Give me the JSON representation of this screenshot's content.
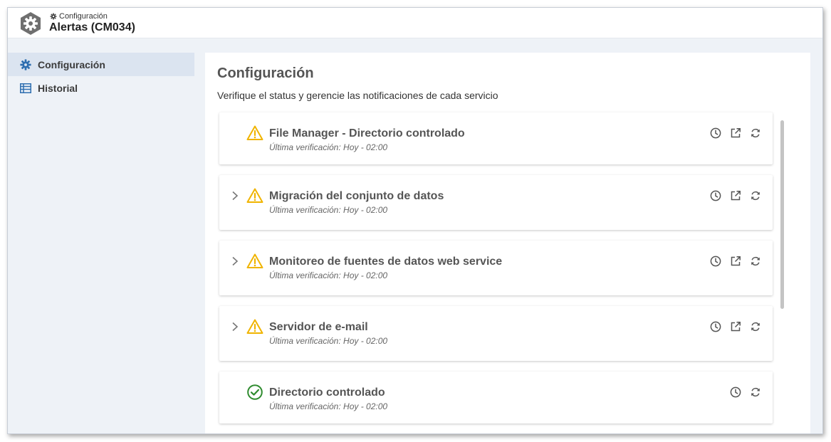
{
  "header": {
    "breadcrumb": "Configuración",
    "title": "Alertas (CM034)"
  },
  "sidebar": {
    "items": [
      {
        "label": "Configuración",
        "icon": "gear-icon",
        "active": true
      },
      {
        "label": "Historial",
        "icon": "table-icon",
        "active": false
      }
    ]
  },
  "main": {
    "title": "Configuración",
    "subtitle": "Verifique el status y gerencie las notificaciones de cada servicio"
  },
  "services": [
    {
      "title": "File Manager - Directorio controlado",
      "meta": "Última verificación: Hoy - 02:00",
      "status": "warning",
      "expandable": false
    },
    {
      "title": "Migración del conjunto de datos",
      "meta": "Última verificación: Hoy - 02:00",
      "status": "warning",
      "expandable": true
    },
    {
      "title": "Monitoreo de fuentes de datos web service",
      "meta": "Última verificación: Hoy - 02:00",
      "status": "warning",
      "expandable": true
    },
    {
      "title": "Servidor de e-mail",
      "meta": "Última verificación: Hoy - 02:00",
      "status": "warning",
      "expandable": true
    },
    {
      "title": "Directorio controlado",
      "meta": "Última verificación: Hoy - 02:00",
      "status": "ok",
      "expandable": false
    }
  ],
  "colors": {
    "warning": "#f0b400",
    "ok": "#2e8b2e",
    "accent": "#2f6fb0",
    "sidebar_active_bg": "#dbe4f0"
  }
}
